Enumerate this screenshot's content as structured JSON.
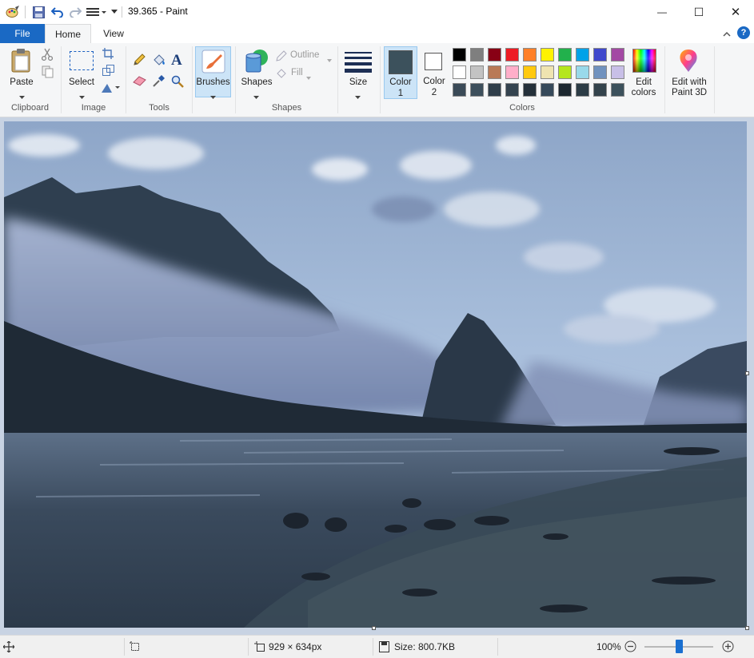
{
  "window": {
    "title": "39.365 - Paint",
    "minimize_glyph": "—",
    "maximize_glyph": "☐",
    "close_glyph": "✕"
  },
  "tabs": {
    "file": "File",
    "home": "Home",
    "view": "View"
  },
  "ribbon": {
    "clipboard": {
      "paste_label": "Paste",
      "group_label": "Clipboard"
    },
    "image": {
      "select_label": "Select",
      "group_label": "Image"
    },
    "tools": {
      "group_label": "Tools"
    },
    "brushes": {
      "label": "Brushes"
    },
    "shapes": {
      "label": "Shapes",
      "outline_label": "Outline",
      "fill_label": "Fill",
      "group_label": "Shapes"
    },
    "size": {
      "label": "Size"
    },
    "colors": {
      "color1_label": "Color",
      "color1_num": "1",
      "color2_label": "Color",
      "color2_num": "2",
      "group_label": "Colors",
      "color1_value": "#3c515c",
      "color2_value": "#ffffff",
      "palette_row1": [
        "#000000",
        "#7f7f7f",
        "#880015",
        "#ed1c24",
        "#ff7f27",
        "#fff200",
        "#22b14c",
        "#00a2e8",
        "#3f48cc",
        "#a349a4"
      ],
      "palette_row2": [
        "#ffffff",
        "#c3c3c3",
        "#b97a57",
        "#ffaec9",
        "#ffc90e",
        "#efe4b0",
        "#b5e61d",
        "#99d9ea",
        "#7092be",
        "#c8bfe7"
      ],
      "palette_row3": [
        "#3a4a57",
        "#3d4f5c",
        "#2f3e4a",
        "#34434f",
        "#24303a",
        "#36495a",
        "#1c2730",
        "#2c3c46",
        "#33434c",
        "#3c515c"
      ],
      "edit_colors_line1": "Edit",
      "edit_colors_line2": "colors"
    },
    "paint3d": {
      "line1": "Edit with",
      "line2": "Paint 3D"
    }
  },
  "status": {
    "dimensions": "929 × 634px",
    "size": "Size: 800.7KB",
    "zoom": "100%",
    "zoom_level_percent": 100
  }
}
